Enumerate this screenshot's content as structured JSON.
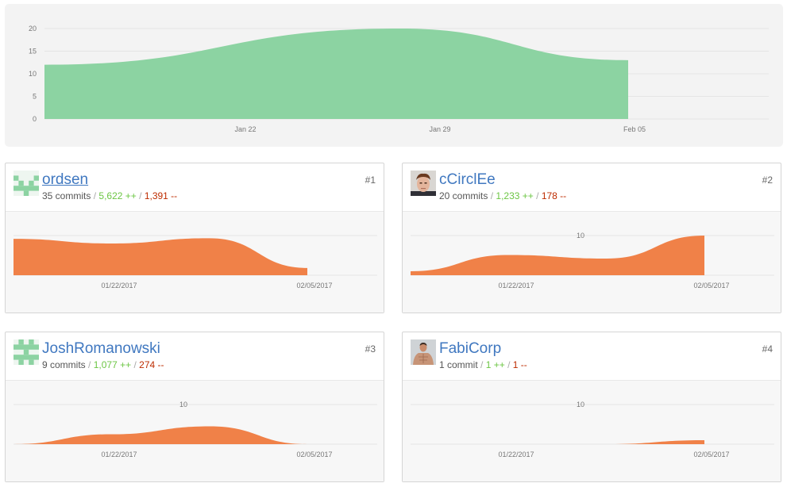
{
  "colors": {
    "overview_fill": "#8cd3a2",
    "contributor_fill": "#f08148",
    "link": "#4078c0",
    "additions": "#6cc644",
    "deletions": "#bd2c00"
  },
  "overview": {
    "y_ticks": [
      "20",
      "15",
      "10",
      "5",
      "0"
    ],
    "x_ticks": [
      "Jan 22",
      "Jan 29",
      "Feb 05"
    ]
  },
  "chart_data": [
    {
      "type": "area",
      "title": "",
      "x": [
        "Jan 15",
        "Jan 29",
        "Feb 05"
      ],
      "values": [
        12,
        20,
        13
      ],
      "ylim": [
        0,
        20
      ],
      "y_ticks": [
        0,
        5,
        10,
        15,
        20
      ],
      "x_ticks": [
        "Jan 22",
        "Jan 29",
        "Feb 05"
      ],
      "grid": true
    }
  ],
  "contributors": [
    {
      "name": "ordsen",
      "rank": "#1",
      "avatar": "identicon-green",
      "commits": "35 commits",
      "additions": "5,622 ++",
      "deletions": "1,391 --",
      "x_ticks": [
        "01/22/2017",
        "02/05/2017"
      ],
      "y_tick_label": "",
      "series": [
        11,
        9.6,
        11.2,
        2.2
      ],
      "ymax": 12
    },
    {
      "name": "cCirclEe",
      "rank": "#2",
      "avatar": "photo-man-face",
      "commits": "20 commits",
      "additions": "1,233 ++",
      "deletions": "178 --",
      "x_ticks": [
        "01/22/2017",
        "02/05/2017"
      ],
      "y_tick_label": "10",
      "series": [
        1,
        5.1,
        4.2,
        10
      ],
      "ymax": 10
    },
    {
      "name": "JoshRomanowski",
      "rank": "#3",
      "avatar": "identicon-green",
      "commits": "9 commits",
      "additions": "1,077 ++",
      "deletions": "274 --",
      "x_ticks": [
        "01/22/2017",
        "02/05/2017"
      ],
      "y_tick_label": "10",
      "series": [
        0,
        2.5,
        4.5,
        0
      ],
      "ymax": 10
    },
    {
      "name": "FabiCorp",
      "rank": "#4",
      "avatar": "photo-shirtless-man",
      "commits": "1 commit",
      "additions": "1 ++",
      "deletions": "1 --",
      "x_ticks": [
        "01/22/2017",
        "02/05/2017"
      ],
      "y_tick_label": "10",
      "series": [
        0,
        0,
        0,
        1
      ],
      "ymax": 10
    }
  ]
}
